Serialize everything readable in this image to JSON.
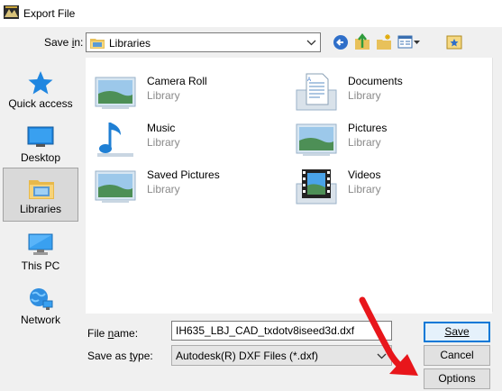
{
  "window": {
    "title": "Export File"
  },
  "toolbar": {
    "save_in_label": "Save in:",
    "save_in_value": "Libraries"
  },
  "places": [
    {
      "label": "Quick access",
      "icon": "star-icon",
      "active": false
    },
    {
      "label": "Desktop",
      "icon": "desktop-icon",
      "active": false
    },
    {
      "label": "Libraries",
      "icon": "libraries-icon",
      "active": true
    },
    {
      "label": "This PC",
      "icon": "computer-icon",
      "active": false
    },
    {
      "label": "Network",
      "icon": "network-icon",
      "active": false
    }
  ],
  "files": [
    {
      "name": "Camera Roll",
      "type": "Library",
      "icon": "picture-library-icon"
    },
    {
      "name": "Documents",
      "type": "Library",
      "icon": "document-library-icon"
    },
    {
      "name": "Music",
      "type": "Library",
      "icon": "music-library-icon"
    },
    {
      "name": "Pictures",
      "type": "Library",
      "icon": "picture-library-icon"
    },
    {
      "name": "Saved Pictures",
      "type": "Library",
      "icon": "picture-library-icon"
    },
    {
      "name": "Videos",
      "type": "Library",
      "icon": "video-library-icon"
    }
  ],
  "form": {
    "file_name_label": "File name:",
    "file_name_value": "IH635_LBJ_CAD_txdotv8iseed3d.dxf",
    "save_as_type_label": "Save as type:",
    "save_as_type_value": "Autodesk(R) DXF Files (*.dxf)"
  },
  "buttons": {
    "save": "Save",
    "cancel": "Cancel",
    "options": "Options"
  },
  "colors": {
    "accent": "#0078d7",
    "annotation_arrow": "#e8161b"
  }
}
